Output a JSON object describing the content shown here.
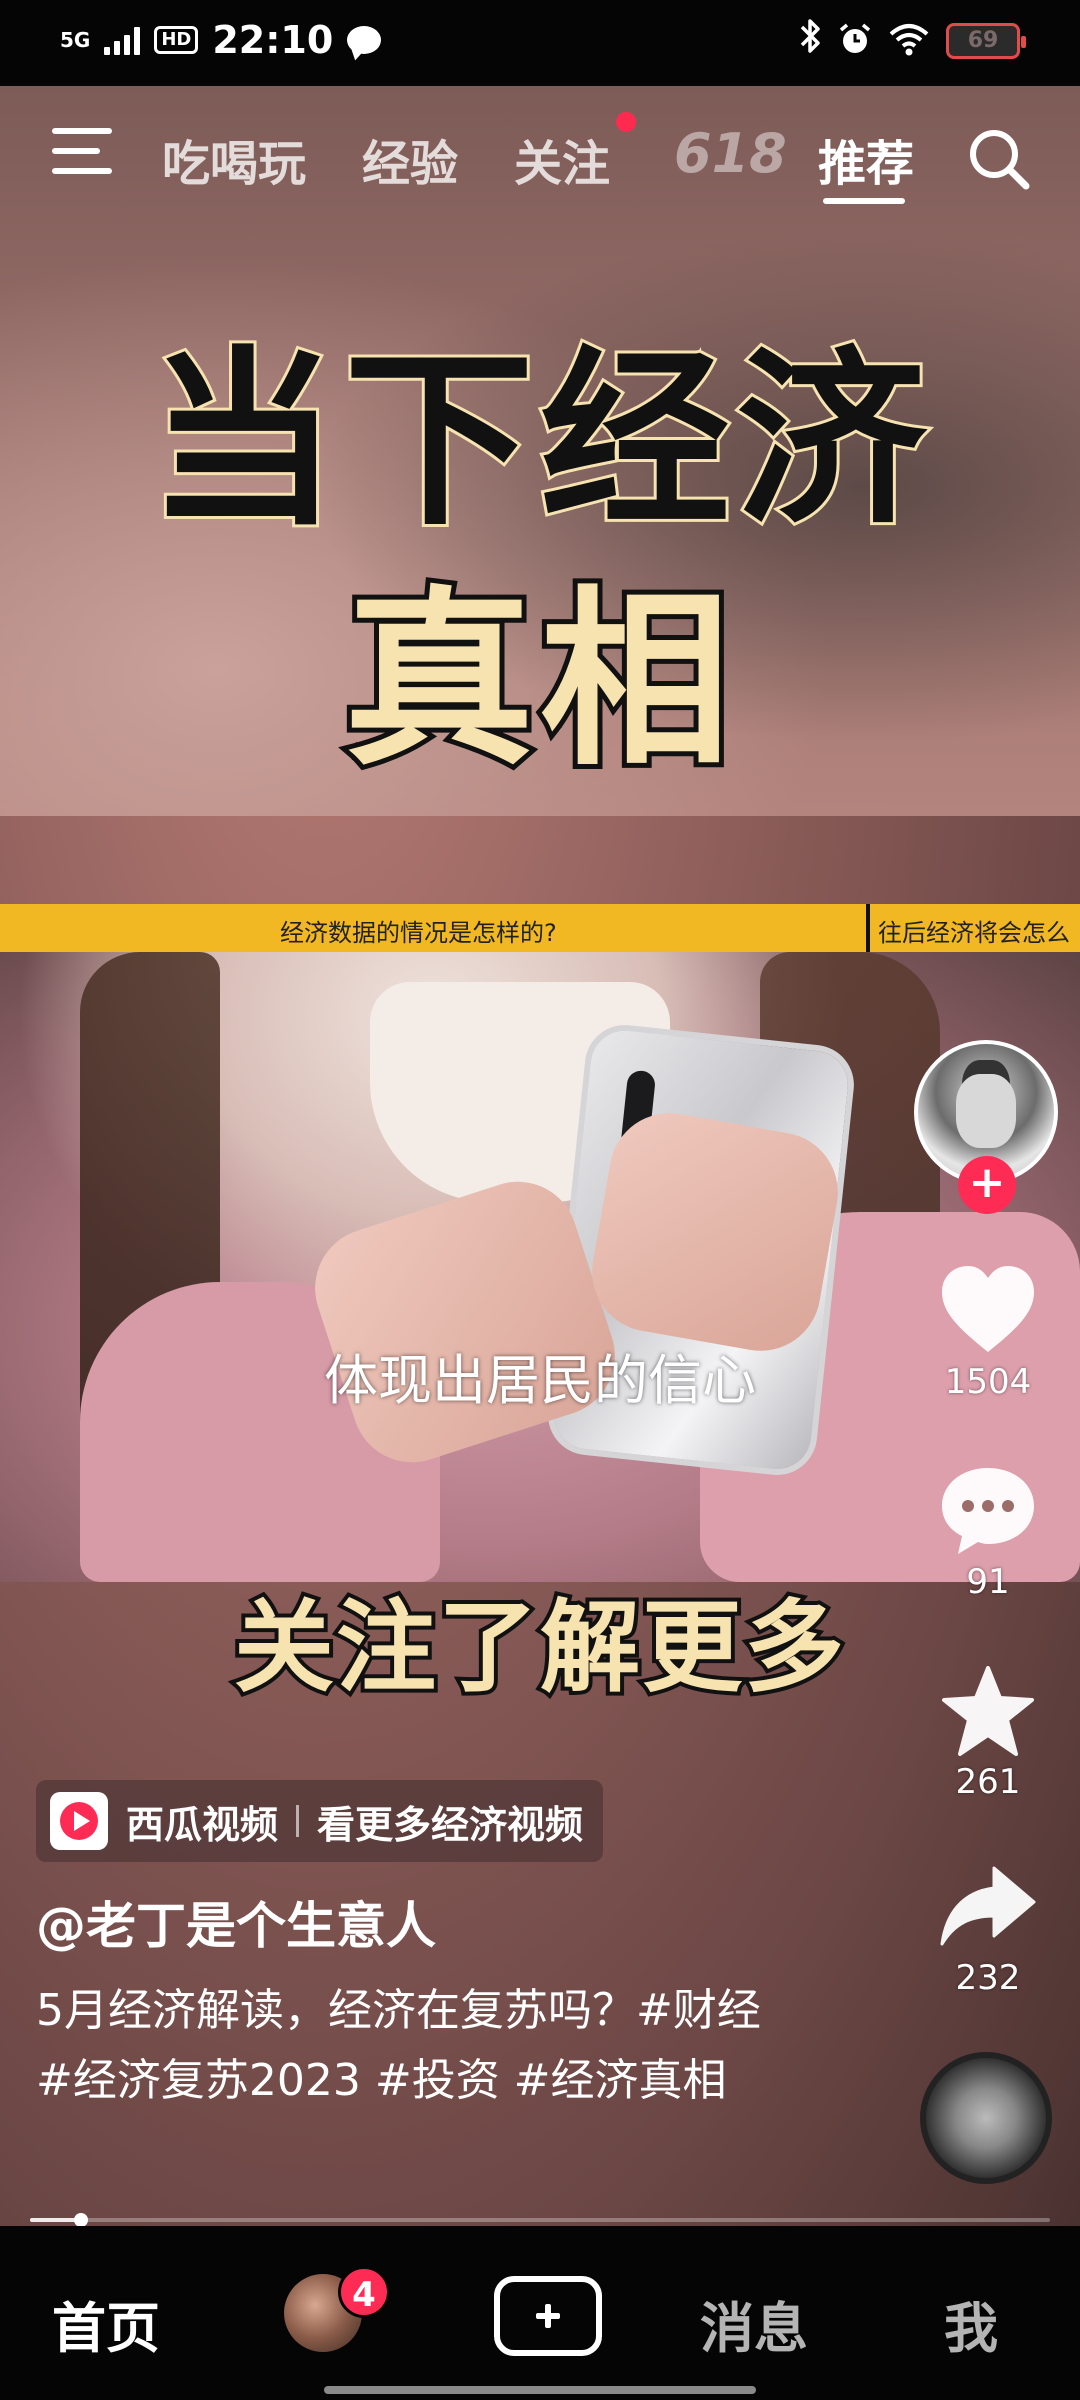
{
  "status_bar": {
    "network": "5G",
    "hd": "HD",
    "time": "22:10",
    "icons": [
      "signal-icon",
      "hd-icon",
      "chat-icon",
      "bluetooth-icon",
      "alarm-icon",
      "wifi-icon",
      "battery-icon"
    ],
    "battery": "69"
  },
  "top_nav": {
    "tabs": [
      "吃喝玩",
      "经验",
      "关注",
      "618",
      "推荐"
    ],
    "active_tab": "推荐"
  },
  "video": {
    "headline_line1": "当下经济",
    "headline_line2": "真相",
    "ticker_1": "经济数据的情况是怎样的?",
    "ticker_2": "往后经济将会怎么",
    "subtitle": "体现出居民的信心",
    "overlay_text": "关注了解更多"
  },
  "rail": {
    "likes": "1504",
    "comments": "91",
    "favorites": "261",
    "shares": "232"
  },
  "info": {
    "promo_app": "西瓜视频",
    "promo_text": "看更多经济视频",
    "author": "@老丁是个生意人",
    "caption": "5月经济解读，经济在复苏吗？#财经 #经济复苏2023 #投资 #经济真相",
    "progress": 0.05
  },
  "tab_bar": {
    "home": "首页",
    "friends_badge": "4",
    "messages": "消息",
    "me": "我"
  },
  "colors": {
    "accent_red": "#fe2c55",
    "ticker_yellow": "#f2b824",
    "headline_cream": "#f6e3b0"
  }
}
